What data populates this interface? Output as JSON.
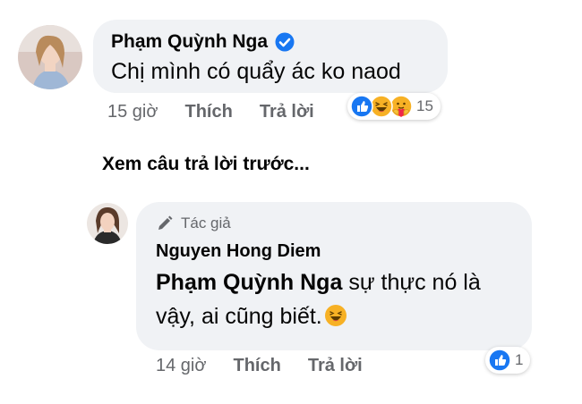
{
  "comment1": {
    "author": "Phạm Quỳnh Nga",
    "verified": true,
    "text": "Chị mình có quẩy ác ko naod",
    "time": "15 giờ",
    "like_label": "Thích",
    "reply_label": "Trả lời",
    "reactions": [
      "like-icon",
      "laughing-icon",
      "care-icon"
    ],
    "reaction_count": "15"
  },
  "view_previous": "Xem câu trả lời trước...",
  "comment2": {
    "badge": "Tác giả",
    "author": "Nguyen Hong Diem",
    "mention": "Phạm Quỳnh Nga",
    "text": " sự thực nó là vậy, ai cũng biết.",
    "emoji": "laughing-icon",
    "time": "14 giờ",
    "like_label": "Thích",
    "reply_label": "Trả lời",
    "reactions": [
      "like-icon"
    ],
    "reaction_count": "1"
  },
  "colors": {
    "bubble": "#f0f2f5",
    "meta_text": "#65676b",
    "like_blue": "#1877f2",
    "verified_blue": "#1877f2",
    "emoji_yellow": "#f7b125"
  }
}
